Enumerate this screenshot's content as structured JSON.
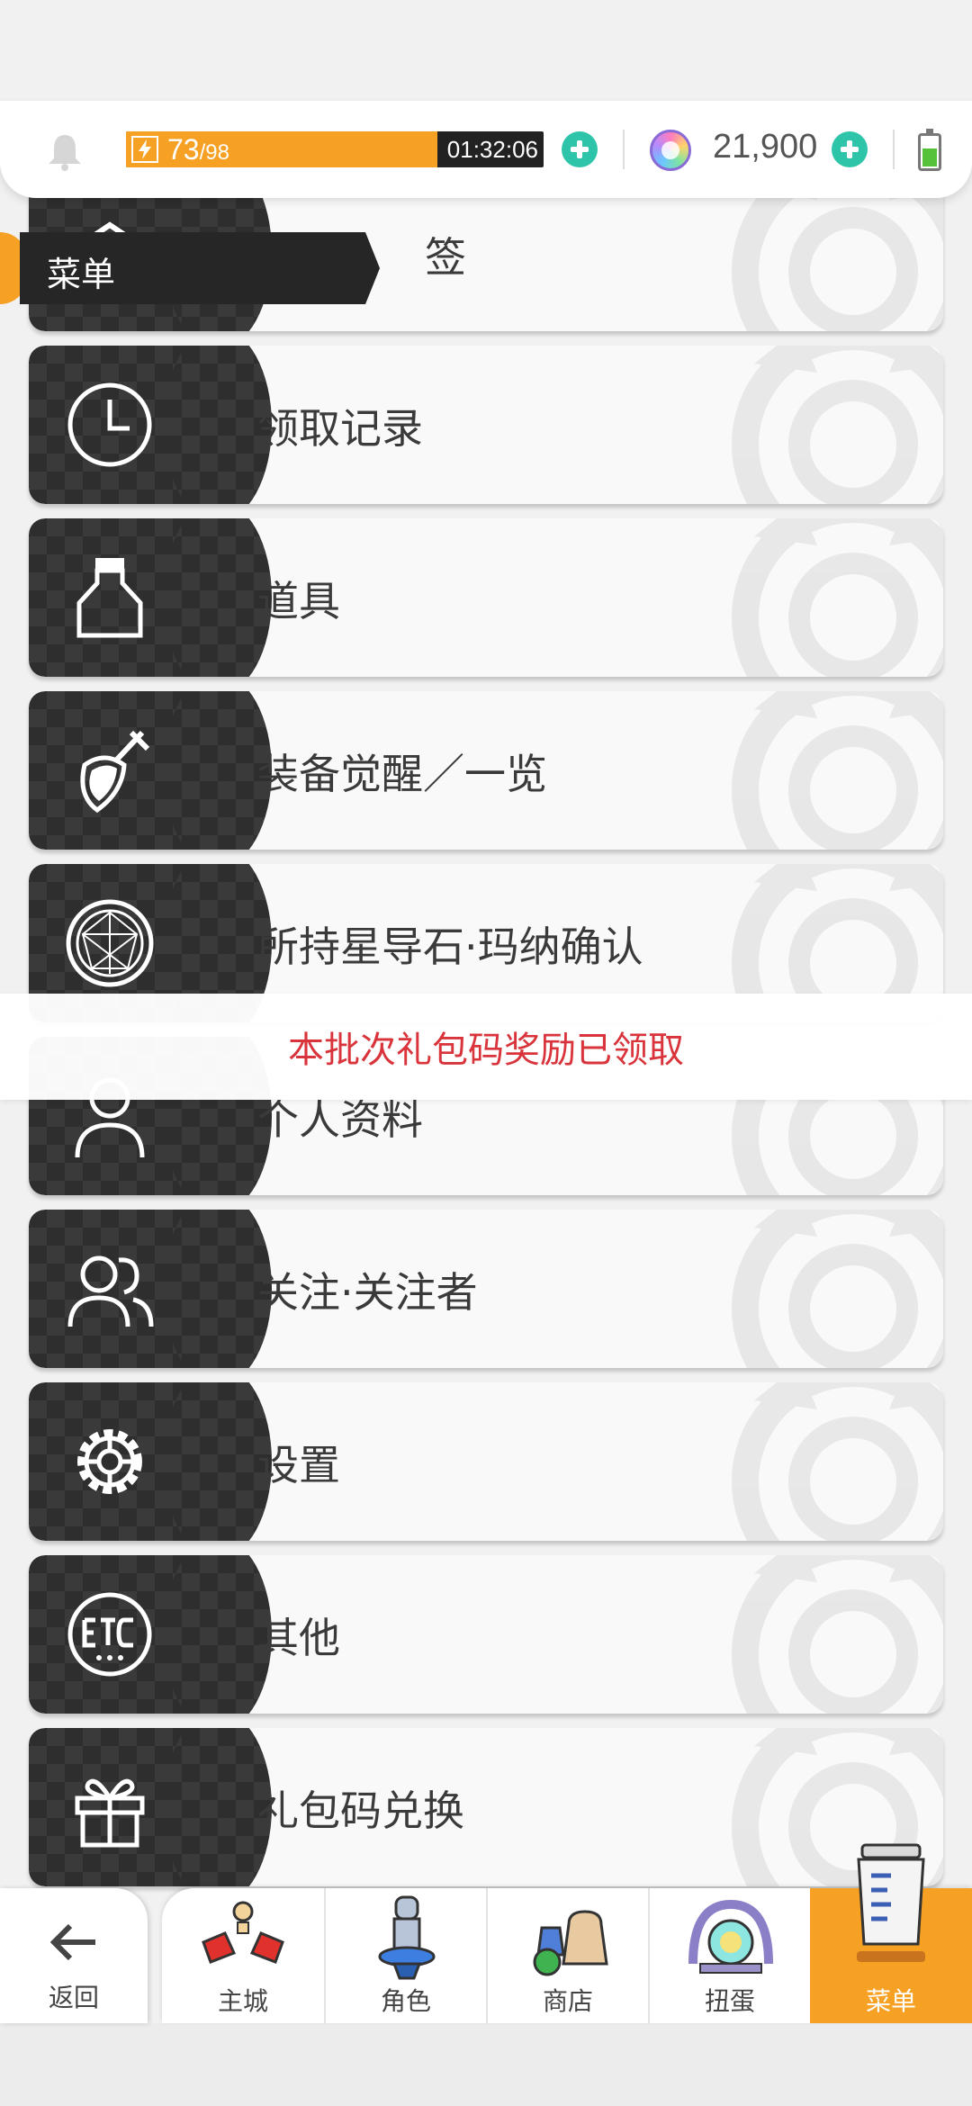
{
  "status": {
    "stamina_current": "73",
    "stamina_max": "98",
    "stamina_fraction": 0.745,
    "stamina_timer": "01:32:06",
    "gems": "21,900",
    "battery_level": 0.5
  },
  "section": {
    "label": "菜单"
  },
  "menu": {
    "items": [
      {
        "label": "签",
        "icon": "book-icon"
      },
      {
        "label": "领取记录",
        "icon": "clock-icon"
      },
      {
        "label": "道具",
        "icon": "bottle-icon"
      },
      {
        "label": "装备觉醒／一览",
        "icon": "sword-shield-icon"
      },
      {
        "label": "所持星导石·玛纳确认",
        "icon": "gem-icon"
      },
      {
        "label": "个人资料",
        "icon": "profile-icon"
      },
      {
        "label": "关注·关注者",
        "icon": "followers-icon"
      },
      {
        "label": "设置",
        "icon": "gear-icon"
      },
      {
        "label": "其他",
        "icon": "etc-icon"
      },
      {
        "label": "礼包码兑换",
        "icon": "gift-icon"
      }
    ]
  },
  "toast": {
    "message": "本批次礼包码奖励已领取"
  },
  "bottom_nav": {
    "back_label": "返回",
    "tabs": [
      {
        "label": "主城",
        "icon": "town-icon"
      },
      {
        "label": "角色",
        "icon": "character-icon"
      },
      {
        "label": "商店",
        "icon": "shop-icon"
      },
      {
        "label": "扭蛋",
        "icon": "gacha-icon"
      },
      {
        "label": "菜单",
        "icon": "menu-jar-icon",
        "active": true
      }
    ]
  },
  "colors": {
    "accent_orange": "#f6a124",
    "plus_teal": "#2ec4a9",
    "toast_red": "#d9343b",
    "icon_panel": "#2e2e2e"
  }
}
